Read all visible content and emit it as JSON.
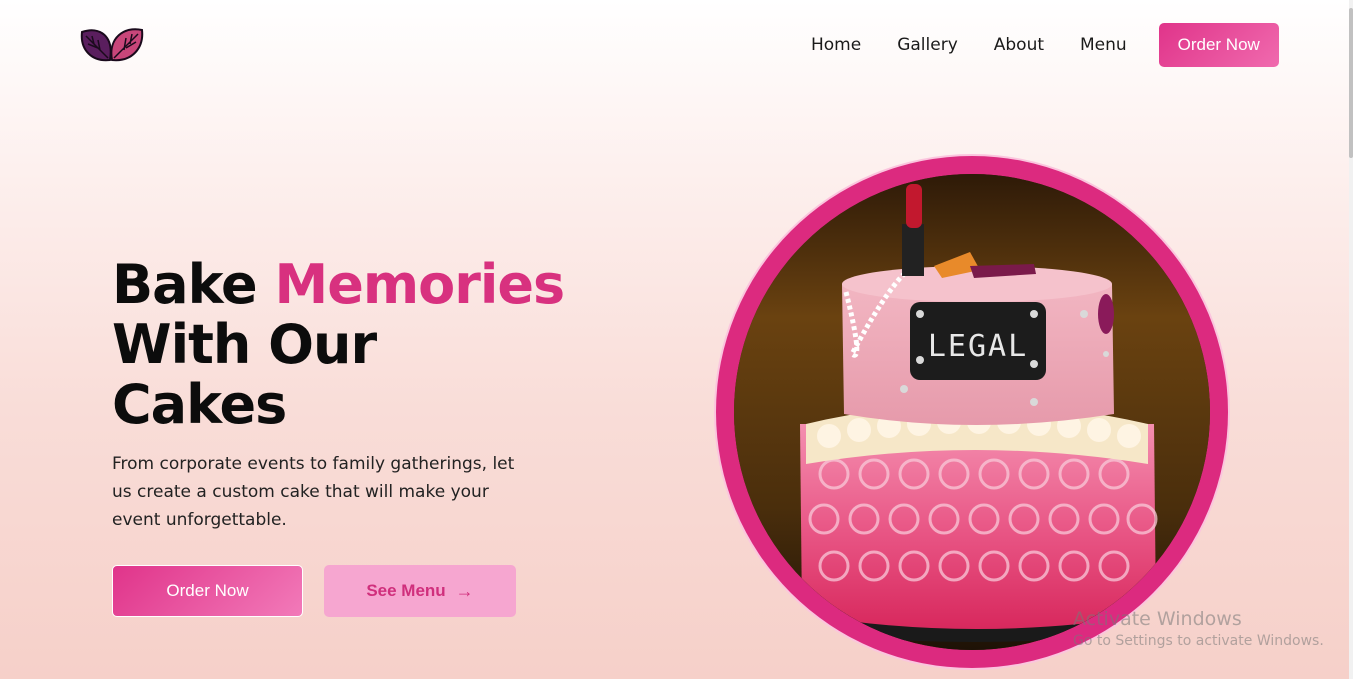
{
  "nav": {
    "items": [
      {
        "label": "Home"
      },
      {
        "label": "Gallery"
      },
      {
        "label": "About"
      },
      {
        "label": "Menu"
      }
    ],
    "order_label": "Order Now"
  },
  "hero": {
    "title_word1": "Bake",
    "title_accent": "Memories",
    "title_line2": "With Our",
    "title_line3": "Cakes",
    "description": "From corporate events to family gatherings, let us create a custom cake that will make your event unforgettable.",
    "order_button": "Order Now",
    "menu_button": "See Menu"
  },
  "cake_sign": "LEGAL",
  "watermark": {
    "title": "Activate Windows",
    "subtitle": "Go to Settings to activate Windows."
  },
  "colors": {
    "accent": "#d8317f",
    "ring": "#dc2a7f",
    "menu_button_bg": "#f6a6d0"
  },
  "icons": {
    "logo": "leaves-logo-icon",
    "arrow": "arrow-right-icon"
  }
}
